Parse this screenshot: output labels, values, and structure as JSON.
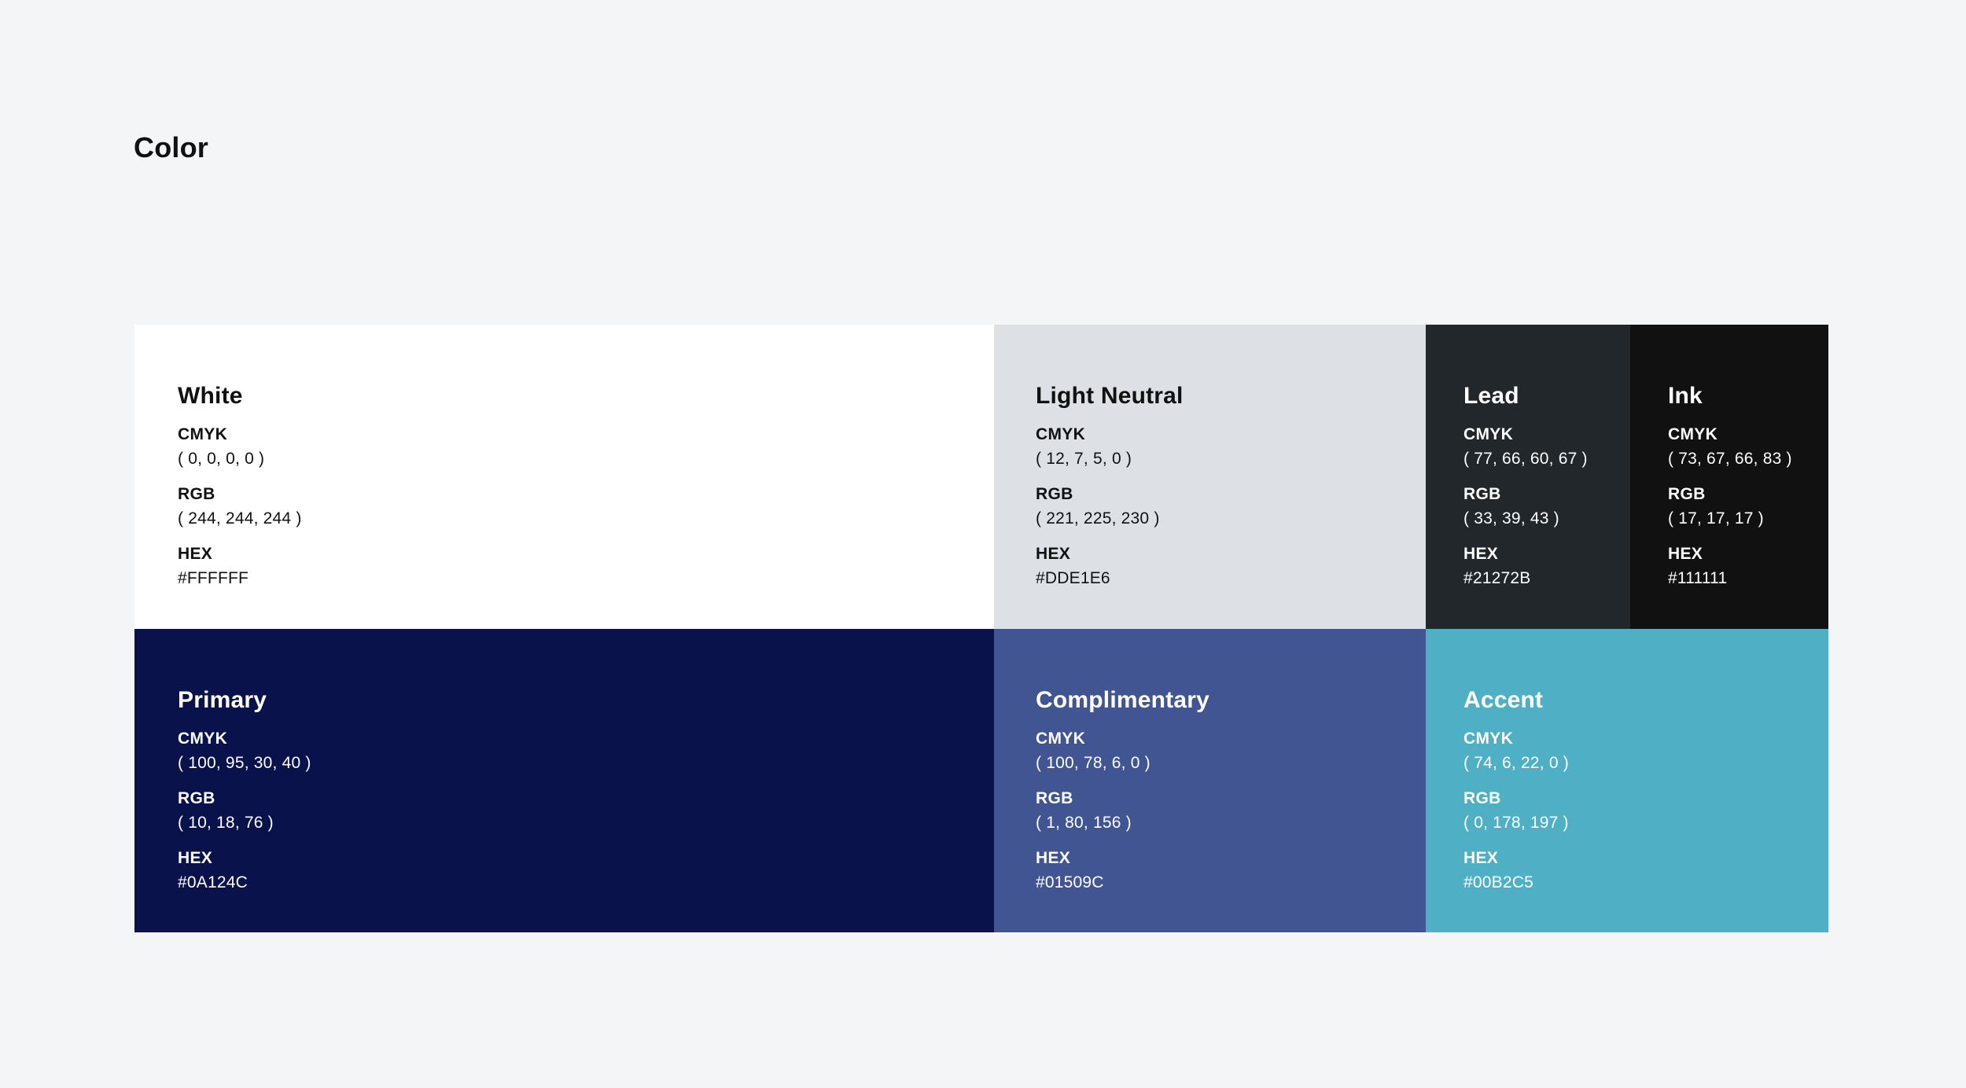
{
  "page": {
    "title": "Color",
    "background": "#F4F5F7"
  },
  "swatches": [
    {
      "key": "white",
      "name": "White",
      "bg": "#FFFFFF",
      "text_color": "#111111",
      "cmyk_label": "CMYK",
      "cmyk": "( 0, 0, 0, 0 )",
      "rgb_label": "RGB",
      "rgb": "( 244, 244, 244 )",
      "hex_label": "HEX",
      "hex": "#FFFFFF"
    },
    {
      "key": "light-neutral",
      "name": "Light Neutral",
      "bg": "#DDE1E6",
      "text_color": "#111111",
      "cmyk_label": "CMYK",
      "cmyk": "( 12, 7, 5, 0 )",
      "rgb_label": "RGB",
      "rgb": "( 221, 225, 230 )",
      "hex_label": "HEX",
      "hex": "#DDE1E6"
    },
    {
      "key": "lead",
      "name": "Lead",
      "bg": "#21272B",
      "text_color": "#FFFFFF",
      "cmyk_label": "CMYK",
      "cmyk": "( 77, 66, 60, 67 )",
      "rgb_label": "RGB",
      "rgb": "( 33, 39, 43 )",
      "hex_label": "HEX",
      "hex": "#21272B"
    },
    {
      "key": "ink",
      "name": "Ink",
      "bg": "#111111",
      "text_color": "#FFFFFF",
      "cmyk_label": "CMYK",
      "cmyk": "( 73, 67, 66, 83 )",
      "rgb_label": "RGB",
      "rgb": "( 17, 17, 17 )",
      "hex_label": "HEX",
      "hex": "#111111"
    },
    {
      "key": "primary",
      "name": "Primary",
      "bg": "#0A124C",
      "text_color": "#FFFFFF",
      "cmyk_label": "CMYK",
      "cmyk": "( 100, 95, 30, 40 )",
      "rgb_label": "RGB",
      "rgb": "( 10, 18, 76 )",
      "hex_label": "HEX",
      "hex": "#0A124C"
    },
    {
      "key": "complimentary",
      "name": "Complimentary",
      "bg": "#405591",
      "text_color": "#FFFFFF",
      "cmyk_label": "CMYK",
      "cmyk": "( 100, 78, 6, 0 )",
      "rgb_label": "RGB",
      "rgb": "( 1, 80, 156 )",
      "hex_label": "HEX",
      "hex": "#01509C"
    },
    {
      "key": "accent",
      "name": "Accent",
      "bg": "#4FB0C5",
      "text_color": "#FFFFFF",
      "cmyk_label": "CMYK",
      "cmyk": "( 74, 6, 22, 0 )",
      "rgb_label": "RGB",
      "rgb": "( 0, 178, 197 )",
      "hex_label": "HEX",
      "hex": "#00B2C5"
    }
  ]
}
